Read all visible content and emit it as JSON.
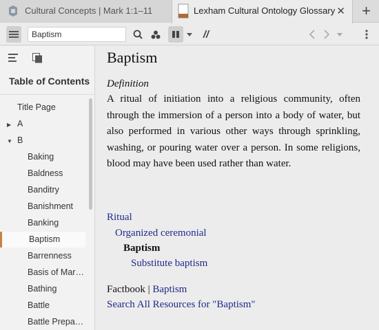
{
  "tabs": [
    {
      "label": "Cultural Concepts | Mark 1:1–11",
      "active": false
    },
    {
      "label": "Lexham Cultural Ontology Glossary",
      "active": true
    }
  ],
  "tab_close": "✕",
  "tab_add": "+",
  "toolbar": {
    "search_value": "Baptism",
    "parallel_label": "//"
  },
  "sidebar": {
    "toc_title": "Table of Contents",
    "items": [
      {
        "label": "Title Page"
      },
      {
        "label": "A"
      },
      {
        "label": "B"
      },
      {
        "label": "Baking"
      },
      {
        "label": "Baldness"
      },
      {
        "label": "Banditry"
      },
      {
        "label": "Banishment"
      },
      {
        "label": "Banking"
      },
      {
        "label": "Baptism"
      },
      {
        "label": "Barrenness"
      },
      {
        "label": "Basis of Mar…"
      },
      {
        "label": "Bathing"
      },
      {
        "label": "Battle"
      },
      {
        "label": "Battle Prepa…"
      }
    ]
  },
  "article": {
    "title": "Baptism",
    "definition_label": "Definition",
    "definition_text": "A ritual of initiation into a religious community, often through the immersion of a person into a body of water, but also performed in various other ways through sprinkling, washing, or pouring water over a person. In some religions, blood may have been used rather than water.",
    "hierarchy": [
      "Ritual",
      "Organized ceremonial",
      "Baptism",
      "Substitute baptism"
    ],
    "factbook_label": "Factbook",
    "factbook_sep": " | ",
    "factbook_link": "Baptism",
    "search_all": "Search All Resources for \"Baptism\""
  },
  "colors": {
    "accent": "#c9813f",
    "link": "#1f2a8a"
  }
}
